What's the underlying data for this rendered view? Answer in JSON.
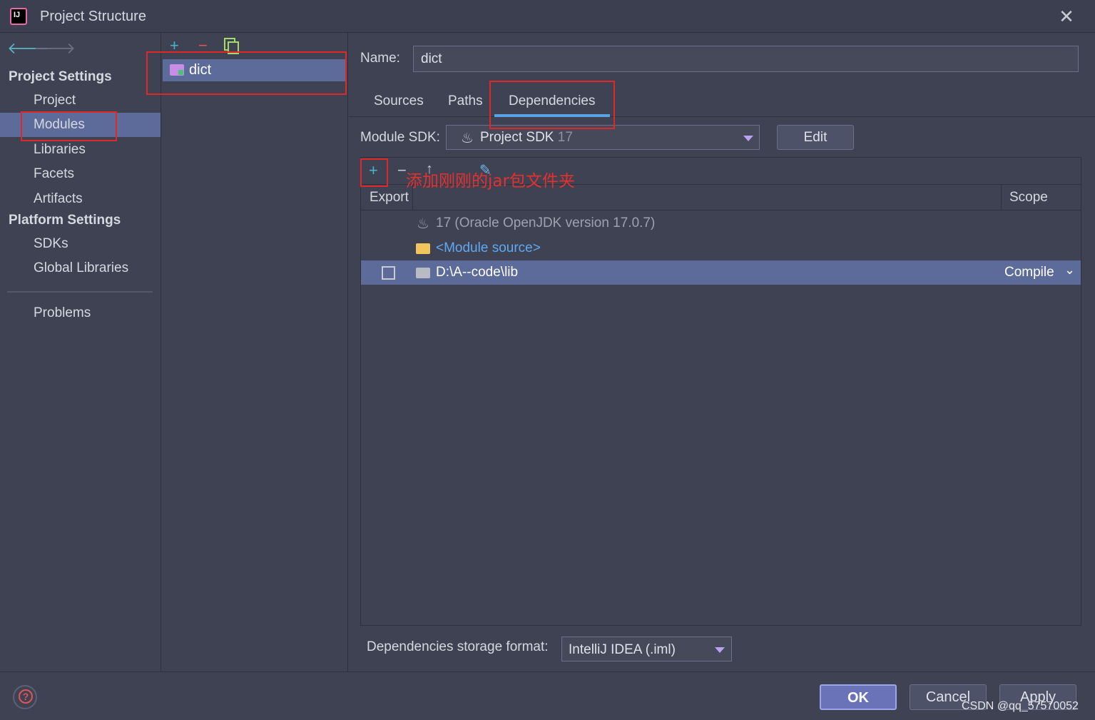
{
  "window": {
    "title": "Project Structure",
    "close_icon": "close-icon"
  },
  "sidebar": {
    "project_settings_heading": "Project Settings",
    "project_items": [
      {
        "label": "Project"
      },
      {
        "label": "Modules",
        "selected": true
      },
      {
        "label": "Libraries"
      },
      {
        "label": "Facets"
      },
      {
        "label": "Artifacts"
      }
    ],
    "platform_settings_heading": "Platform Settings",
    "platform_items": [
      {
        "label": "SDKs"
      },
      {
        "label": "Global Libraries"
      }
    ],
    "problems_label": "Problems"
  },
  "modules": {
    "items": [
      {
        "name": "dict"
      }
    ]
  },
  "module_details": {
    "name_label": "Name:",
    "name_value": "dict",
    "tabs": [
      {
        "label": "Sources"
      },
      {
        "label": "Paths"
      },
      {
        "label": "Dependencies",
        "active": true
      }
    ],
    "sdk_label": "Module SDK:",
    "sdk_value": "Project SDK",
    "sdk_version": "17",
    "edit_label": "Edit",
    "annotation": "添加刚刚的jar包文件夹",
    "table": {
      "col_export": "Export",
      "col_scope": "Scope",
      "rows": [
        {
          "text": "17 (Oracle OpenJDK version 17.0.7)"
        },
        {
          "text": "<Module source>"
        },
        {
          "text": "D:\\A--code\\lib",
          "scope": "Compile",
          "export_checked": false,
          "selected": true
        }
      ]
    },
    "storage_label": "Dependencies storage format:",
    "storage_value": "IntelliJ IDEA (.iml)"
  },
  "buttons": {
    "ok": "OK",
    "cancel": "Cancel",
    "apply": "Apply",
    "help": "?"
  },
  "watermark": "CSDN @qq_57570052",
  "colors": {
    "selection": "#5d6b9a",
    "accent_tab": "#5aa2e6",
    "highlight_box": "#e02828",
    "annotation": "#e53030"
  }
}
